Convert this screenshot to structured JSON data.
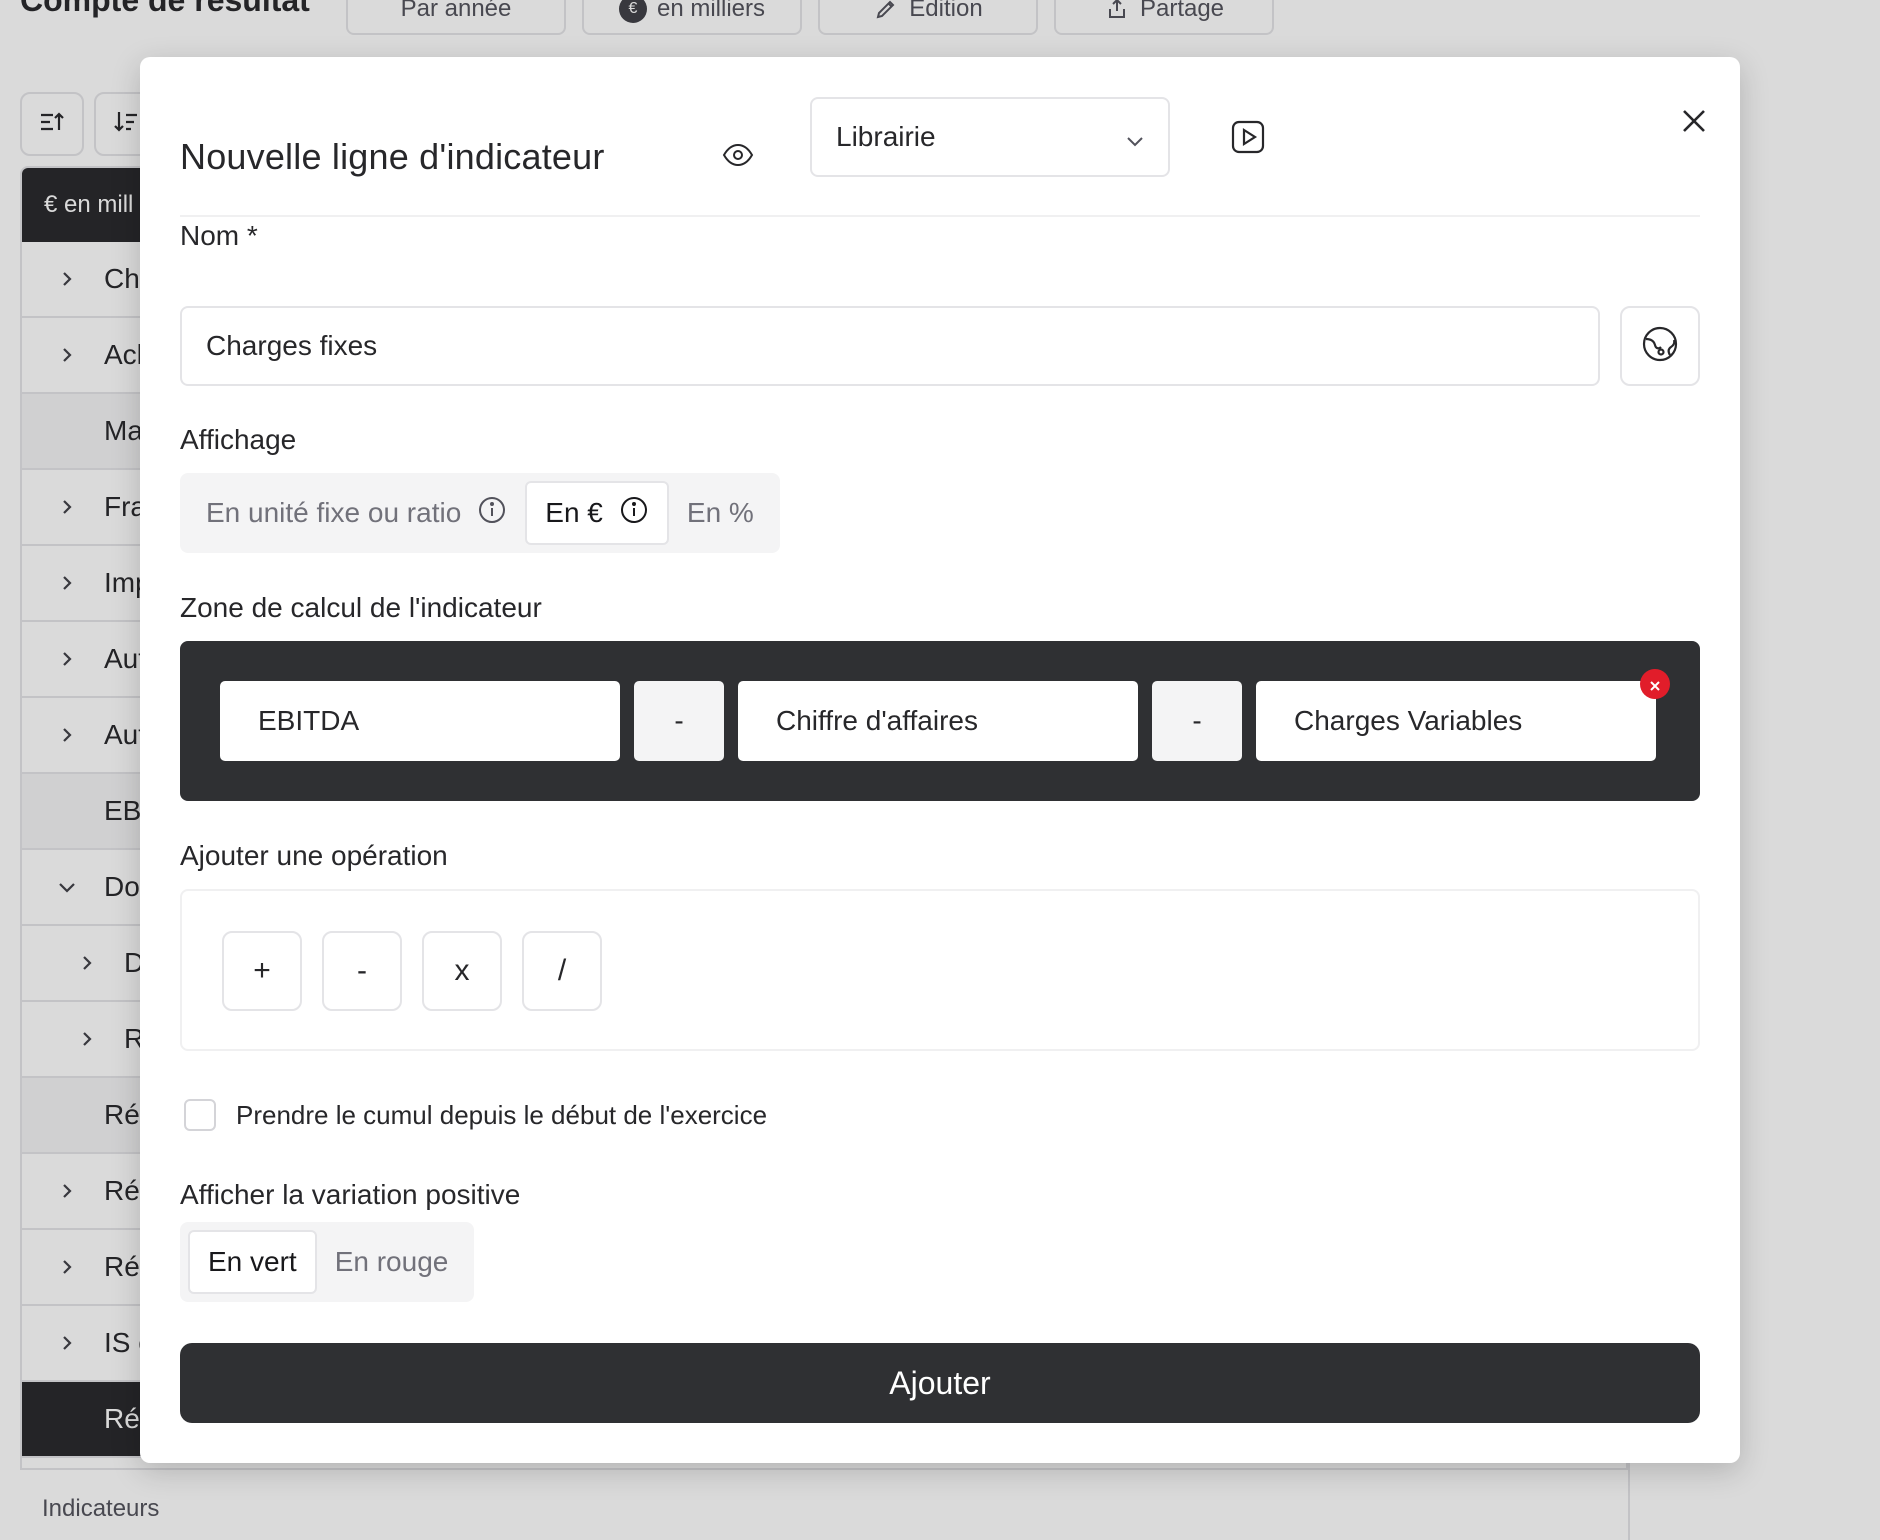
{
  "background": {
    "page_title": "Compte de résultat",
    "toolbar": [
      {
        "label": "Par année",
        "icon": ""
      },
      {
        "label": "en milliers",
        "icon": "euro-badge-icon"
      },
      {
        "label": "Edition",
        "icon": "pencil-icon"
      },
      {
        "label": "Partage",
        "icon": "share-icon"
      }
    ],
    "currency_badge": "€",
    "table_header": "€ en mill",
    "rows": [
      {
        "label": "Ch",
        "chev": "right",
        "style": "normal"
      },
      {
        "label": "Ach",
        "chev": "right",
        "style": "normal"
      },
      {
        "label": "Ma",
        "chev": "",
        "style": "shaded"
      },
      {
        "label": "Fra",
        "chev": "right",
        "style": "normal"
      },
      {
        "label": "Imp",
        "chev": "right",
        "style": "normal"
      },
      {
        "label": "Aut",
        "chev": "right",
        "style": "normal"
      },
      {
        "label": "Aut",
        "chev": "right",
        "style": "normal"
      },
      {
        "label": "EB",
        "chev": "",
        "style": "shaded"
      },
      {
        "label": "Dot",
        "chev": "down",
        "style": "normal"
      },
      {
        "label": "D",
        "chev": "right-sub",
        "style": "normal"
      },
      {
        "label": "R",
        "chev": "right-sub",
        "style": "normal"
      },
      {
        "label": "Rés",
        "chev": "",
        "style": "shaded"
      },
      {
        "label": "Rés",
        "chev": "right",
        "style": "normal"
      },
      {
        "label": "Rés",
        "chev": "right",
        "style": "normal"
      },
      {
        "label": "IS e",
        "chev": "right",
        "style": "normal"
      },
      {
        "label": "Rés",
        "chev": "",
        "style": "dark"
      }
    ],
    "footer_label": "Indicateurs"
  },
  "modal": {
    "title": "Nouvelle ligne d'indicateur",
    "library_select": {
      "value": "Librairie"
    },
    "name": {
      "label": "Nom *",
      "value": "Charges fixes"
    },
    "display": {
      "label": "Affichage",
      "options": [
        "En unité fixe ou ratio",
        "En €",
        "En %"
      ],
      "selected": "En €"
    },
    "calc_zone": {
      "label": "Zone de calcul de l'indicateur",
      "tokens": [
        "EBITDA",
        "-",
        "Chiffre d'affaires",
        "-",
        "Charges Variables"
      ]
    },
    "add_operation": {
      "label": "Ajouter une opération",
      "operators": [
        "+",
        "-",
        "x",
        "/"
      ]
    },
    "cumulative": {
      "label": "Prendre le cumul depuis le début de l'exercice",
      "checked": false
    },
    "positive_variation": {
      "label": "Afficher la variation positive",
      "options": [
        "En vert",
        "En rouge"
      ],
      "selected": "En vert"
    },
    "submit_label": "Ajouter"
  },
  "colors": {
    "dark": "#2f3033",
    "remove_red": "#e11d2a",
    "segment_bg": "#f4f4f5",
    "border": "#e4e4e7"
  }
}
